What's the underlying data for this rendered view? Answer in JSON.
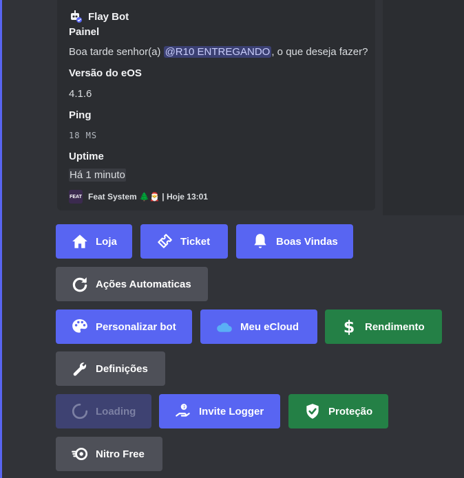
{
  "embed": {
    "author": "Flay Bot",
    "title": "Painel",
    "description_prefix": "Boa tarde senhor(a) ",
    "mention": "@R10 ENTREGANDO",
    "description_suffix": ", o que deseja fazer?",
    "fields": [
      {
        "name": "Versão do eOS",
        "value": "4.1.6"
      },
      {
        "name": "Ping",
        "value": "18 MS"
      },
      {
        "name": "Uptime",
        "value": "Há 1 minuto"
      }
    ],
    "footer_icon_text": "FEAT",
    "footer_text": "Feat System 🌲🎅 | Hoje 13:01"
  },
  "buttons": {
    "loja": "Loja",
    "ticket": "Ticket",
    "boas_vindas": "Boas Vindas",
    "acoes": "Ações Automaticas",
    "personalizar": "Personalizar bot",
    "ecloud": "Meu eCloud",
    "rendimento": "Rendimento",
    "definicoes": "Definições",
    "loading": "Loading",
    "invite_logger": "Invite Logger",
    "protecao": "Proteção",
    "nitro": "Nitro Free"
  },
  "colors": {
    "primary": "#5865f2",
    "secondary": "#4e5058",
    "success": "#248046",
    "background": "#313338",
    "embed": "#2b2d31"
  }
}
